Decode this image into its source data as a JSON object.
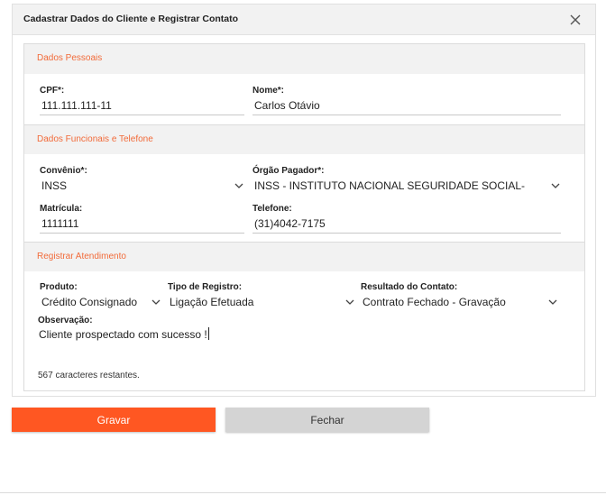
{
  "dialog": {
    "title": "Cadastrar Dados do Cliente e Registrar Contato",
    "close_icon": "close-icon"
  },
  "sections": {
    "personal": {
      "title": "Dados Pessoais"
    },
    "functional": {
      "title": "Dados Funcionais e Telefone"
    },
    "service": {
      "title": "Registrar Atendimento"
    }
  },
  "fields": {
    "cpf": {
      "label": "CPF*:",
      "value": "111.111.111-11"
    },
    "nome": {
      "label": "Nome*:",
      "value": "Carlos Otávio"
    },
    "convenio": {
      "label": "Convênio*:",
      "value": "INSS"
    },
    "orgao": {
      "label": "Órgão Pagador*:",
      "value": "INSS - INSTITUTO NACIONAL SEGURIDADE SOCIAL-"
    },
    "matricula": {
      "label": "Matrícula:",
      "value": "1111111"
    },
    "telefone": {
      "label": "Telefone:",
      "value": "(31)4042-7175"
    },
    "produto": {
      "label": "Produto:",
      "value": "Crédito Consignado"
    },
    "tipo_registro": {
      "label": "Tipo de Registro:",
      "value": "Ligação Efetuada"
    },
    "resultado": {
      "label": "Resultado do Contato:",
      "value": "Contrato Fechado - Gravação"
    },
    "observacao": {
      "label": "Observação:",
      "value": "Cliente prospectado com sucesso !"
    }
  },
  "chars_remaining": "567 caracteres restantes.",
  "buttons": {
    "save": "Gravar",
    "close": "Fechar"
  },
  "colors": {
    "accent": "#f26b3a",
    "primary_button": "#ff5722",
    "secondary_button": "#d4d4d4"
  }
}
